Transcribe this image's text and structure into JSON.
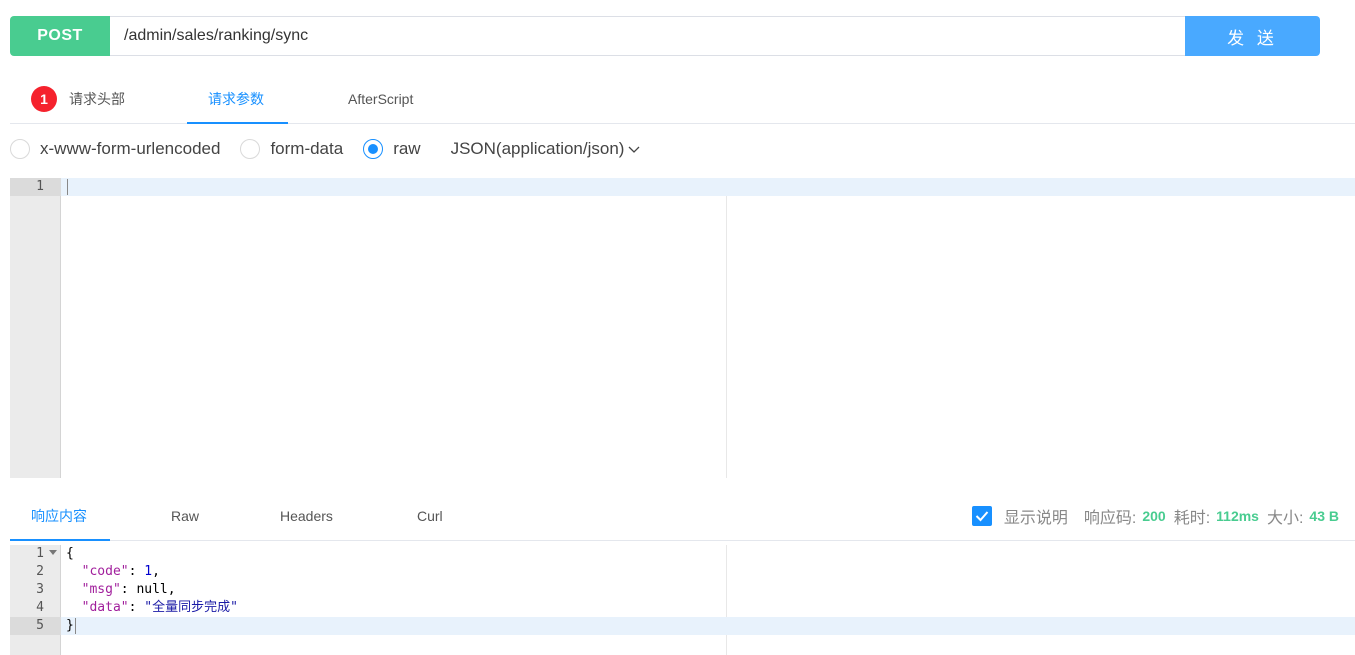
{
  "request": {
    "method": "POST",
    "url": "/admin/sales/ranking/sync",
    "send_label": "发 送"
  },
  "request_tabs": {
    "headers_badge": "1",
    "headers_label": "请求头部",
    "params_label": "请求参数",
    "afterscript_label": "AfterScript",
    "active": "请求参数"
  },
  "body_types": {
    "urlencoded": "x-www-form-urlencoded",
    "formdata": "form-data",
    "raw": "raw",
    "selected": "raw",
    "content_type": "JSON(application/json)"
  },
  "request_editor": {
    "line_numbers": [
      "1"
    ],
    "content": ""
  },
  "response_tabs": {
    "content_label": "响应内容",
    "raw_label": "Raw",
    "headers_label": "Headers",
    "curl_label": "Curl",
    "active": "响应内容"
  },
  "response_meta": {
    "show_desc_label": "显示说明",
    "show_desc_checked": true,
    "code_label": "响应码:",
    "code_value": "200",
    "time_label": "耗时:",
    "time_value": "112ms",
    "size_label": "大小:",
    "size_value": "43 B"
  },
  "response_editor": {
    "line_numbers": [
      "1",
      "2",
      "3",
      "4",
      "5"
    ],
    "lines": {
      "l1": "{",
      "l2_key": "\"code\"",
      "l2_rest": ": ",
      "l2_val": "1",
      "l2_end": ",",
      "l3_key": "\"msg\"",
      "l3_rest": ": null,",
      "l4_key": "\"data\"",
      "l4_rest": ": ",
      "l4_val": "\"全量同步完成\"",
      "l5": "}"
    }
  },
  "colors": {
    "method_bg": "#49cc90",
    "send_bg": "#49a9ff",
    "accent": "#1890ff",
    "badge": "#f5222d",
    "meta_value": "#49cc90"
  },
  "icons": {
    "dropdown": "chevron-down-icon",
    "checkbox": "checkmark-icon",
    "fold": "fold-arrow-icon"
  }
}
